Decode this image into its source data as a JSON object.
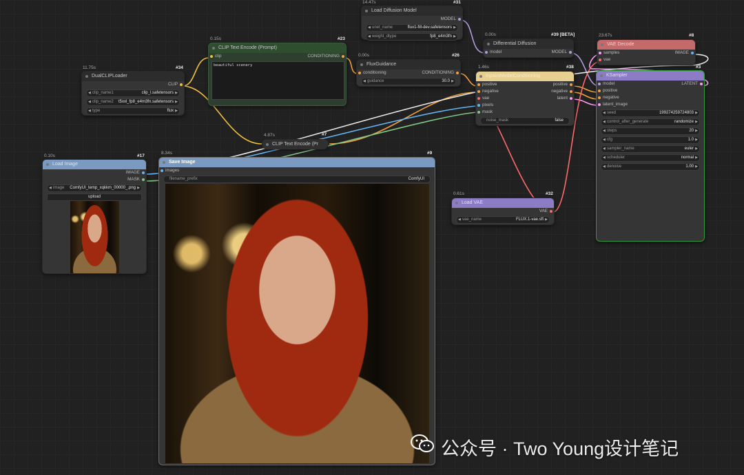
{
  "colors": {
    "clip_wire": "#f0c040",
    "conditioning_wire": "#f0a040",
    "model_wire": "#b39ddb",
    "vae_wire": "#ff6b6b",
    "latent_wire": "#ff9cf9",
    "image_wire": "#64b5f6",
    "mask_wire": "#81c784",
    "ksampler_border": "#2e9a3a",
    "clip_text_encode_header": "#2f4d2f",
    "vae_decode_header": "#c56a6a",
    "inpaint_header": "#e6cf8f",
    "load_image_header": "#7b9ac2",
    "save_image_header": "#7b9ac2",
    "ksampler_header": "#8c7cc5",
    "load_vae_header": "#8c7cc5"
  },
  "nodes": {
    "dual_clip_loader": {
      "timing": "11.75s",
      "id": "#34",
      "title": "DualCLIPLoader",
      "output": "CLIP",
      "widgets": [
        {
          "label": "clip_name1",
          "value": "clip_l.safetensors"
        },
        {
          "label": "clip_name2",
          "value": "t5xxl_fp8_e4m3fn.safetensors"
        },
        {
          "label": "type",
          "value": "flux"
        }
      ]
    },
    "clip_text_encode_prompt": {
      "timing": "0.15s",
      "id": "#23",
      "title": "CLIP Text Encode (Prompt)",
      "input": "clip",
      "output": "CONDITIONING",
      "text": "beautiful scenery"
    },
    "load_diffusion_model": {
      "timing": "14.47s",
      "id": "#31",
      "title": "Load Diffusion Model",
      "output": "MODEL",
      "widgets": [
        {
          "label": "unet_name",
          "value": "flux1-fill-dev.safetensors"
        },
        {
          "label": "weight_dtype",
          "value": "fp8_e4m3fn"
        }
      ]
    },
    "flux_guidance": {
      "timing": "0.00s",
      "id": "#26",
      "title": "FluxGuidance",
      "input": "conditioning",
      "output": "CONDITIONING",
      "widgets": [
        {
          "label": "guidance",
          "value": "30.0"
        }
      ]
    },
    "differential_diffusion": {
      "timing": "0.00s",
      "id": "#39 [BETA]",
      "title": "Differential Diffusion",
      "input": "model",
      "output": "MODEL"
    },
    "vae_decode": {
      "timing": "23.67s",
      "id": "#8",
      "title": "VAE Decode",
      "inputs": [
        "samples",
        "vae"
      ],
      "output": "IMAGE"
    },
    "inpaint_model_conditioning": {
      "timing": "1.46s",
      "id": "#38",
      "title": "InpaintModelConditioning",
      "inputs": [
        "positive",
        "negative",
        "vae",
        "pixels",
        "mask"
      ],
      "outputs": [
        "positive",
        "negative",
        "latent"
      ],
      "widgets": [
        {
          "label": "noise_mask",
          "value": "false"
        }
      ]
    },
    "ksampler": {
      "timing": "",
      "id": "#3",
      "title": "KSampler",
      "inputs": [
        "model",
        "positive",
        "negative",
        "latent_image"
      ],
      "output": "LATENT",
      "widgets": [
        {
          "label": "seed",
          "value": "199274259724803"
        },
        {
          "label": "control_after_generate",
          "value": "randomize"
        },
        {
          "label": "steps",
          "value": "20"
        },
        {
          "label": "cfg",
          "value": "1.0"
        },
        {
          "label": "sampler_name",
          "value": "euler"
        },
        {
          "label": "scheduler",
          "value": "normal"
        },
        {
          "label": "denoise",
          "value": "1.00"
        }
      ]
    },
    "clip_text_encode_collapsed": {
      "timing": "4.87s",
      "id": "#7",
      "title": "CLIP Text Encode (Pr"
    },
    "load_image": {
      "timing": "0.10s",
      "id": "#17",
      "title": "Load Image",
      "outputs": [
        "IMAGE",
        "MASK"
      ],
      "widgets": [
        {
          "label": "image",
          "value": "ComfyUI_temp_xqkkm_00000_.png"
        }
      ],
      "button": "upload"
    },
    "save_image": {
      "timing": "8.34s",
      "id": "#9",
      "title": "Save Image",
      "input": "images",
      "widgets": [
        {
          "label": "filename_prefix",
          "value": "ComfyUI"
        }
      ]
    },
    "load_vae": {
      "timing": "0.61s",
      "id": "#32",
      "title": "Load VAE",
      "output": "VAE",
      "widgets": [
        {
          "label": "vae_name",
          "value": "FLUX.1-vae.sft"
        }
      ]
    }
  },
  "watermark": {
    "text": "公众号 · Two Young设计笔记"
  }
}
